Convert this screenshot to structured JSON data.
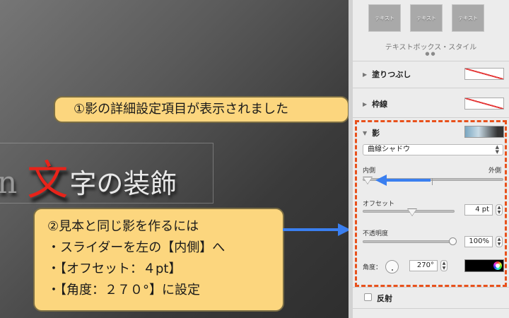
{
  "slide": {
    "text_prefix": "n",
    "text_highlight": "文",
    "text_rest": "字の装飾"
  },
  "callouts": {
    "step1": "①影の詳細設定項目が表示されました",
    "step2_lines": [
      "②見本と同じ影を作るには",
      "・スライダーを左の【内側】へ",
      "・【オフセット：４pt】",
      "・【角度：２７０°】に設定"
    ]
  },
  "inspector": {
    "styles": [
      "テキスト",
      "テキスト",
      "テキスト"
    ],
    "styles_caption": "テキストボックス・スタイル",
    "page_dots": "●●",
    "fill_label": "塗りつぶし",
    "border_label": "枠線",
    "shadow": {
      "label": "影",
      "type_value": "曲線シャドウ",
      "inner_label": "内側",
      "outer_label": "外側",
      "offset_label": "オフセット",
      "offset_value": "4 pt",
      "opacity_label": "不透明度",
      "opacity_value": "100%",
      "angle_label": "角度：",
      "angle_value": "270°",
      "color": "#000000"
    },
    "reflection_label": "反射"
  },
  "colors": {
    "callout_bg": "#fcd67e",
    "highlight": "#e8511c",
    "arrow": "#3a7ff0",
    "slide_red": "#e8231a"
  },
  "icons": [
    "disclosure-triangle-icon",
    "arrow-left-icon",
    "arrow-right-icon",
    "color-wheel-icon",
    "stepper-icon"
  ]
}
